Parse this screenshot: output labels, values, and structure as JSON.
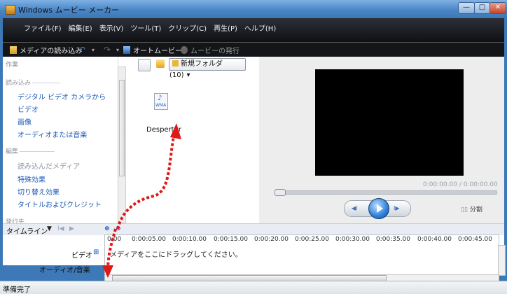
{
  "window": {
    "title": "Windows ムービー メーカー"
  },
  "menubar": {
    "items": [
      "ファイル(F)",
      "編集(E)",
      "表示(V)",
      "ツール(T)",
      "クリップ(C)",
      "再生(P)",
      "ヘルプ(H)"
    ]
  },
  "toolbar": {
    "import_media": "メディアの読み込み",
    "auto_movie": "オートムービー",
    "publish": "ムービーの発行"
  },
  "taskpane": {
    "header": "作業",
    "import_section": "読み込み",
    "import_items": [
      "デジタル ビデオ カメラから",
      "ビデオ",
      "画像",
      "オーディオまたは音楽"
    ],
    "edit_section": "編集",
    "edit_items": [
      "読み込んだメディア",
      "特殊効果",
      "切り替え効果",
      "タイトルおよびクレジット"
    ],
    "publish_section": "発行先"
  },
  "collections": {
    "folder_dropdown": "新規フォルダ (10)",
    "file_icon_label": "WMA",
    "file_name": "Despertar"
  },
  "preview": {
    "timecode": "0:00:00.00 / 0:00:00.00",
    "split_label": "分割",
    "playback_progress": 0
  },
  "timeline": {
    "label": "タイムライン",
    "ruler_ticks": [
      "0:00",
      "0:00:05.00",
      "0:00:10.00",
      "0:00:15.00",
      "0:00:20.00",
      "0:00:25.00",
      "0:00:30.00",
      "0:00:35.00",
      "0:00:40.00",
      "0:00:45.00"
    ],
    "video_track_label": "ビデオ",
    "audio_track_label": "オーディオ/音楽",
    "drag_hint": "メディアをここにドラッグしてください。"
  },
  "status": {
    "text": "準備完了"
  },
  "colors": {
    "annotation_arrow": "#e01818",
    "link": "#1b58b8",
    "accent": "#2e7fd8"
  }
}
